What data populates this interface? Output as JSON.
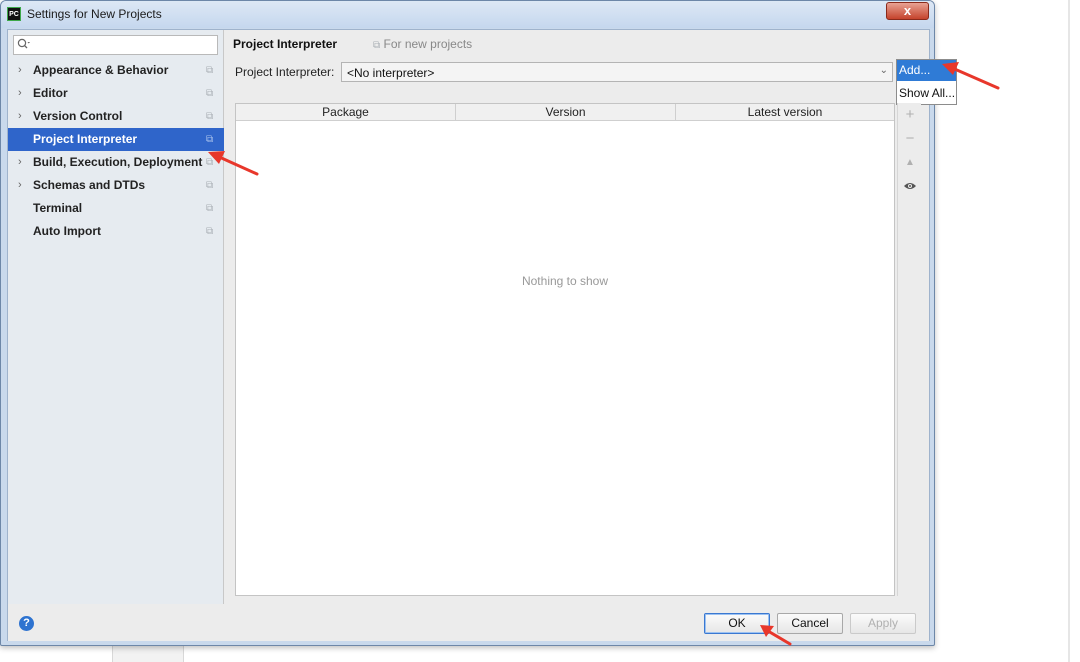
{
  "window": {
    "title": "Settings for New Projects",
    "app_icon_text": "PC",
    "close_glyph": "x"
  },
  "sidebar": {
    "search_placeholder": "",
    "items": [
      {
        "label": "Appearance & Behavior",
        "expandable": true,
        "selected": false
      },
      {
        "label": "Editor",
        "expandable": true,
        "selected": false
      },
      {
        "label": "Version Control",
        "expandable": true,
        "selected": false
      },
      {
        "label": "Project Interpreter",
        "expandable": false,
        "selected": true
      },
      {
        "label": "Build, Execution, Deployment",
        "expandable": true,
        "selected": false
      },
      {
        "label": "Schemas and DTDs",
        "expandable": true,
        "selected": false
      },
      {
        "label": "Terminal",
        "expandable": false,
        "selected": false
      },
      {
        "label": "Auto Import",
        "expandable": false,
        "selected": false
      }
    ]
  },
  "content": {
    "title": "Project Interpreter",
    "subtitle": "For new projects",
    "interpreter_label": "Project Interpreter:",
    "interpreter_value": "<No interpreter>",
    "popup": {
      "items": [
        "Add...",
        "Show All..."
      ]
    },
    "table": {
      "columns": [
        "Package",
        "Version",
        "Latest version"
      ],
      "rows": [],
      "empty_text": "Nothing to show"
    },
    "tools": [
      "plus-icon",
      "minus-icon",
      "up-arrow-icon",
      "eye-icon"
    ]
  },
  "footer": {
    "ok_label": "OK",
    "cancel_label": "Cancel",
    "apply_label": "Apply",
    "help_glyph": "?"
  },
  "colors": {
    "selection": "#2f65ca",
    "popup_active": "#2f7bd6",
    "annotation_arrow": "#e8372b"
  }
}
